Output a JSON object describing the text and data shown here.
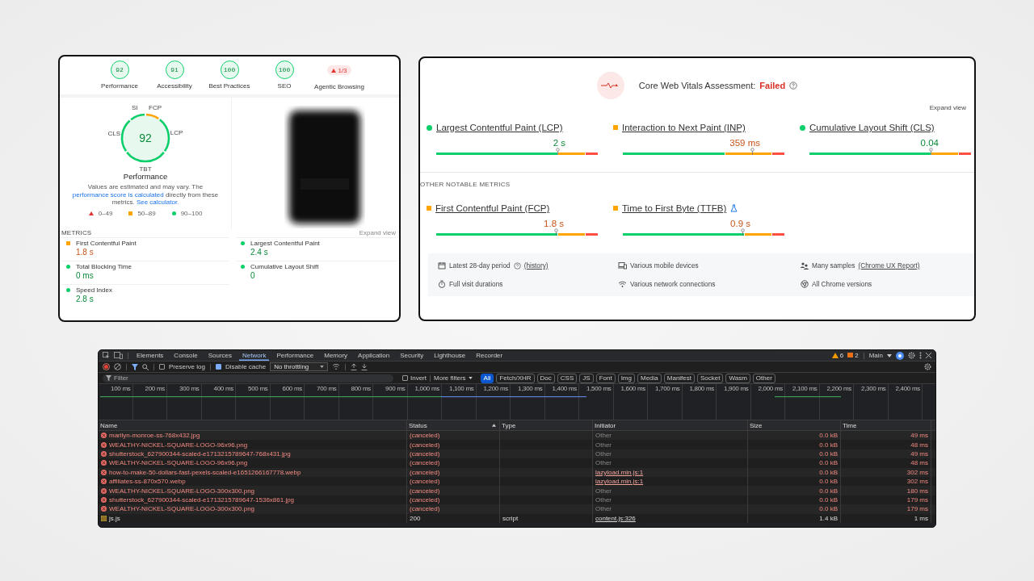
{
  "lighthouse": {
    "categories": [
      {
        "kind": "gauge",
        "score": "92",
        "label": "Performance"
      },
      {
        "kind": "gauge",
        "score": "91",
        "label": "Accessibility"
      },
      {
        "kind": "gauge",
        "score": "100",
        "label": "Best Practices"
      },
      {
        "kind": "gauge",
        "score": "100",
        "label": "SEO"
      },
      {
        "kind": "warning",
        "score": "1/3",
        "label": "Agentic Browsing"
      }
    ],
    "performance": {
      "score": "92",
      "title": "Performance",
      "segments": [
        {
          "label": "SI",
          "color": "#0cce6b"
        },
        {
          "label": "FCP",
          "color": "#ffa400"
        },
        {
          "label": "LCP",
          "color": "#0cce6b"
        },
        {
          "label": "TBT",
          "color": "#0cce6b"
        },
        {
          "label": "CLS",
          "color": "#0cce6b"
        }
      ],
      "description": [
        {
          "kind": "text",
          "text": "Values are estimated and may vary. The "
        },
        {
          "kind": "link",
          "text": "performance score is calculated"
        },
        {
          "kind": "text",
          "text": " directly from these metrics. "
        },
        {
          "kind": "link",
          "text": "See calculator."
        }
      ],
      "legend": [
        {
          "kind": "triangle",
          "label": "0–49"
        },
        {
          "kind": "square",
          "label": "50–89"
        },
        {
          "kind": "circle",
          "label": "90–100"
        }
      ]
    },
    "metrics_heading": "METRICS",
    "expand_label": "Expand view",
    "metrics": [
      {
        "label": "First Contentful Paint",
        "value": "1.8 s",
        "color": "#ffa400"
      },
      {
        "label": "Largest Contentful Paint",
        "value": "2.4 s",
        "color": "#0cce6b"
      },
      {
        "label": "Total Blocking Time",
        "value": "0 ms",
        "color": "#0cce6b"
      },
      {
        "label": "Cumulative Layout Shift",
        "value": "0",
        "color": "#0cce6b"
      },
      {
        "label": "Speed Index",
        "value": "2.8 s",
        "color": "#0cce6b"
      }
    ]
  },
  "crux": {
    "title": "Core Web Vitals Assessment:",
    "status": "Failed",
    "expand_label": "Expand view",
    "core_metrics": [
      {
        "label": "Largest Contentful Paint (LCP)",
        "value": "2 s",
        "color": "#0cce6b",
        "level": 0.75,
        "experimental": false
      },
      {
        "label": "Interaction to Next Paint (INP)",
        "value": "359 ms",
        "color": "#ffa400",
        "level": 0.8,
        "experimental": false
      },
      {
        "label": "Cumulative Layout Shift (CLS)",
        "value": "0.04",
        "color": "#0cce6b",
        "level": 0.75,
        "experimental": false
      }
    ],
    "other_heading": "OTHER NOTABLE METRICS",
    "other_metrics": [
      {
        "label": "First Contentful Paint (FCP)",
        "value": "1.8 s",
        "color": "#ffa400",
        "level": 0.74,
        "experimental": false
      },
      {
        "label": "Time to First Byte (TTFB)",
        "value": "0.9 s",
        "color": "#ffa400",
        "level": 0.74,
        "experimental": true
      }
    ],
    "footer": [
      {
        "kind": "calendar",
        "text": "Latest 28-day period",
        "help": true,
        "link": "(history)"
      },
      {
        "kind": "devices",
        "text": "Various mobile devices",
        "help": false
      },
      {
        "kind": "people",
        "text": "Many samples",
        "help": false,
        "link": "(Chrome UX Report)"
      },
      {
        "kind": "stopwatch",
        "text": "Full visit durations",
        "help": false
      },
      {
        "kind": "wifi",
        "text": "Various network connections",
        "help": false
      },
      {
        "kind": "chrome",
        "text": "All Chrome versions",
        "help": false
      }
    ]
  },
  "devtools": {
    "tabs": [
      {
        "label": "Elements",
        "selected": false
      },
      {
        "label": "Console",
        "selected": false
      },
      {
        "label": "Sources",
        "selected": false
      },
      {
        "label": "Network",
        "selected": true
      },
      {
        "label": "Performance",
        "selected": false
      },
      {
        "label": "Memory",
        "selected": false
      },
      {
        "label": "Application",
        "selected": false
      },
      {
        "label": "Security",
        "selected": false
      },
      {
        "label": "Lighthouse",
        "selected": false
      },
      {
        "label": "Recorder",
        "selected": false
      }
    ],
    "warnings": "6",
    "messages": "2",
    "target": "Main",
    "preserve_log": {
      "label": "Preserve log",
      "checked": false
    },
    "disable_cache": {
      "label": "Disable cache",
      "checked": true
    },
    "throttling": "No throttling",
    "filter": {
      "placeholder": "Filter"
    },
    "invert": {
      "label": "Invert",
      "checked": false
    },
    "more_filters": "More filters",
    "types": [
      {
        "label": "All",
        "selected": true
      },
      {
        "label": "Fetch/XHR",
        "selected": false
      },
      {
        "label": "Doc",
        "selected": false
      },
      {
        "label": "CSS",
        "selected": false
      },
      {
        "label": "JS",
        "selected": false
      },
      {
        "label": "Font",
        "selected": false
      },
      {
        "label": "Img",
        "selected": false
      },
      {
        "label": "Media",
        "selected": false
      },
      {
        "label": "Manifest",
        "selected": false
      },
      {
        "label": "Socket",
        "selected": false
      },
      {
        "label": "Wasm",
        "selected": false
      },
      {
        "label": "Other",
        "selected": false
      }
    ],
    "timeline_ticks": [
      "100 ms",
      "200 ms",
      "300 ms",
      "400 ms",
      "500 ms",
      "600 ms",
      "700 ms",
      "800 ms",
      "900 ms",
      "1,000 ms",
      "1,100 ms",
      "1,200 ms",
      "1,300 ms",
      "1,400 ms",
      "1,500 ms",
      "1,600 ms",
      "1,700 ms",
      "1,800 ms",
      "1,900 ms",
      "2,000 ms",
      "2,100 ms",
      "2,200 ms",
      "2,300 ms",
      "2,400 ms"
    ],
    "columns": [
      {
        "label": "Name",
        "sorted": false
      },
      {
        "label": "Status",
        "sorted": true
      },
      {
        "label": "Type",
        "sorted": false
      },
      {
        "label": "Initiator",
        "sorted": false
      },
      {
        "label": "Size",
        "sorted": false
      },
      {
        "label": "Time",
        "sorted": false
      }
    ],
    "rows": [
      {
        "name": "marilyn-monroe-ss-768x432.jpg",
        "status": "(canceled)",
        "initiator": "Other",
        "initiator_link": false,
        "size": "0.0 kB",
        "time": "49 ms",
        "failed": true
      },
      {
        "name": "WEALTHY-NICKEL-SQUARE-LOGO-96x96.png",
        "status": "(canceled)",
        "initiator": "Other",
        "initiator_link": false,
        "size": "0.0 kB",
        "time": "48 ms",
        "failed": true
      },
      {
        "name": "shutterstock_627900344-scaled-e1713215789647-768x431.jpg",
        "status": "(canceled)",
        "initiator": "Other",
        "initiator_link": false,
        "size": "0.0 kB",
        "time": "49 ms",
        "failed": true
      },
      {
        "name": "WEALTHY-NICKEL-SQUARE-LOGO-96x96.png",
        "status": "(canceled)",
        "initiator": "Other",
        "initiator_link": false,
        "size": "0.0 kB",
        "time": "48 ms",
        "failed": true
      },
      {
        "name": "how-to-make-50-dollars-fast-pexels-scaled-e1651266167778.webp",
        "status": "(canceled)",
        "initiator": "lazyload.min.js:1",
        "initiator_link": true,
        "size": "0.0 kB",
        "time": "302 ms",
        "failed": true
      },
      {
        "name": "affiliates-ss-870x570.webp",
        "status": "(canceled)",
        "initiator": "lazyload.min.js:1",
        "initiator_link": true,
        "size": "0.0 kB",
        "time": "302 ms",
        "failed": true
      },
      {
        "name": "WEALTHY-NICKEL-SQUARE-LOGO-300x300.png",
        "status": "(canceled)",
        "initiator": "Other",
        "initiator_link": false,
        "size": "0.0 kB",
        "time": "180 ms",
        "failed": true
      },
      {
        "name": "shutterstock_627900344-scaled-e1713215789647-1536x861.jpg",
        "status": "(canceled)",
        "initiator": "Other",
        "initiator_link": false,
        "size": "0.0 kB",
        "time": "179 ms",
        "failed": true
      },
      {
        "name": "WEALTHY-NICKEL-SQUARE-LOGO-300x300.png",
        "status": "(canceled)",
        "initiator": "Other",
        "initiator_link": false,
        "size": "0.0 kB",
        "time": "179 ms",
        "failed": true
      },
      {
        "name": "js.js",
        "status": "200",
        "type": "script",
        "initiator": "content.js:326",
        "initiator_link": true,
        "size": "1.4 kB",
        "time": "1 ms",
        "failed": false
      }
    ]
  }
}
